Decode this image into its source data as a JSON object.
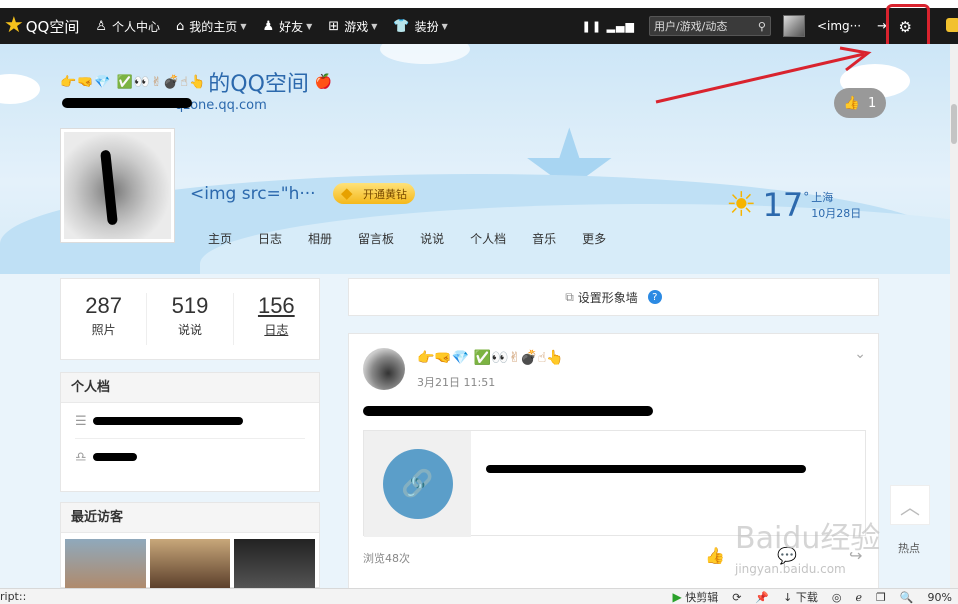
{
  "navbar": {
    "logo_text": "QQ空间",
    "items": [
      {
        "icon": "person-icon",
        "label": "个人中心",
        "caret": false
      },
      {
        "icon": "home-icon",
        "label": "我的主页",
        "caret": true
      },
      {
        "icon": "friends-icon",
        "label": "好友",
        "caret": true
      },
      {
        "icon": "games-grid-icon",
        "label": "游戏",
        "caret": true
      },
      {
        "icon": "shirt-icon",
        "label": "装扮",
        "caret": true
      }
    ],
    "search_placeholder": "用户/游戏/动态",
    "username": "<img···"
  },
  "banner": {
    "title_suffix": "的QQ空间",
    "title_emoji": "👉🤜💎 ✅👀✌💣☝👆",
    "url_text": "qzone.qq.com",
    "like_count": "1",
    "nickname": "<img src=\"h···",
    "vip_label": "开通黄钻",
    "tabs": [
      "主页",
      "日志",
      "相册",
      "留言板",
      "说说",
      "个人档",
      "音乐",
      "更多"
    ],
    "weather": {
      "temp": "17",
      "unit": "°",
      "city": "上海",
      "date": "10月28日"
    }
  },
  "stats": [
    {
      "value": "287",
      "label": "照片",
      "underline": false
    },
    {
      "value": "519",
      "label": "说说",
      "underline": false
    },
    {
      "value": "156",
      "label": "日志",
      "underline": true
    }
  ],
  "profile_card": {
    "title": "个人档"
  },
  "visitors_card": {
    "title": "最近访客"
  },
  "settings_bar": {
    "label": "设置形象墙",
    "help": "?"
  },
  "feed": {
    "name_emoji": "👉🤜💎 ✅👀✌💣☝👆",
    "time": "3月21日 11:51",
    "views": "浏览48次"
  },
  "side": {
    "hot_label": "热点"
  },
  "watermark": {
    "line1": "Baidu经验",
    "line2": "jingyan.baidu.com"
  },
  "statusbar": {
    "left_text": "ript::",
    "clip_label": "快剪辑",
    "download_label": "下载",
    "zoom": "90%"
  }
}
